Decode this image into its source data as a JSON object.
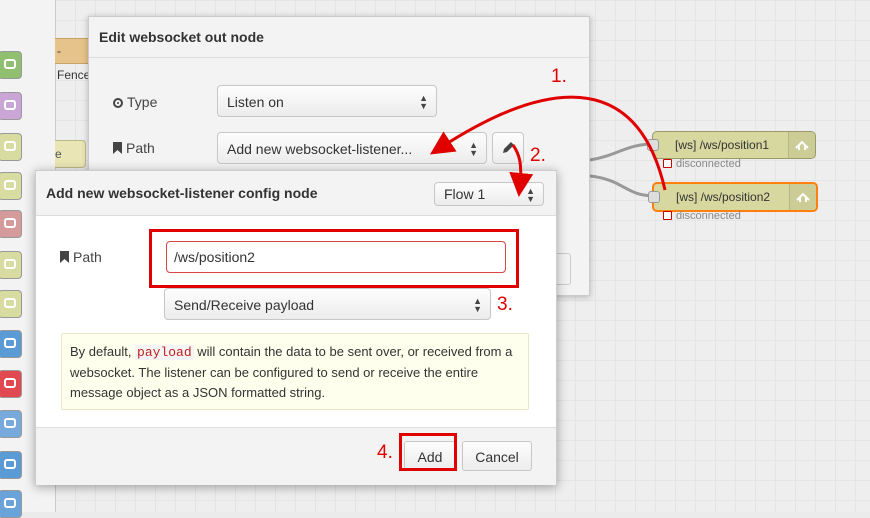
{
  "palette": {
    "fence_label": "-Fence",
    "ghost_label": "e",
    "node_colors": [
      "#8fbf6f",
      "#c9a6d6",
      "#d8dca0",
      "#d8dca0",
      "#d59a9a",
      "#d8dca0",
      "#d8dca0",
      "#5a9bd5",
      "#e2484f",
      "#77a9dd",
      "#5a9bd5",
      "#6aa3d9"
    ],
    "node_icons": [
      "list-icon",
      "sound-wave-icon",
      "bridge-icon",
      "bridge-icon",
      "pulse-icon",
      "feather-icon",
      "feather-icon",
      "arrow-circle-icon",
      "twilio-icon",
      "mobile-icon",
      "chip-icon",
      "share-icon"
    ]
  },
  "flow": {
    "node1_label": "[ws] /ws/position1",
    "node2_label": "[ws] /ws/position2",
    "status1": "disconnected",
    "status2": "disconnected"
  },
  "edit_dialog": {
    "title": "Edit websocket out node",
    "type_label": "Type",
    "type_value": "Listen on",
    "path_label": "Path",
    "path_value": "Add new websocket-listener..."
  },
  "config_dialog": {
    "title": "Add new websocket-listener config node",
    "scope_value": "Flow 1",
    "path_label": "Path",
    "path_value": "/ws/position2",
    "payload_option": "Send/Receive payload",
    "tip_before": "By default, ",
    "tip_code": "payload",
    "tip_after": " will contain the data to be sent over, or received from a websocket. The listener can be configured to send or receive the entire message object as a JSON formatted string.",
    "add_button": "Add",
    "cancel_button": "Cancel"
  },
  "annotations": {
    "step1": "1.",
    "step2": "2.",
    "step3": "3.",
    "step4": "4.",
    "color": "#e00000"
  }
}
